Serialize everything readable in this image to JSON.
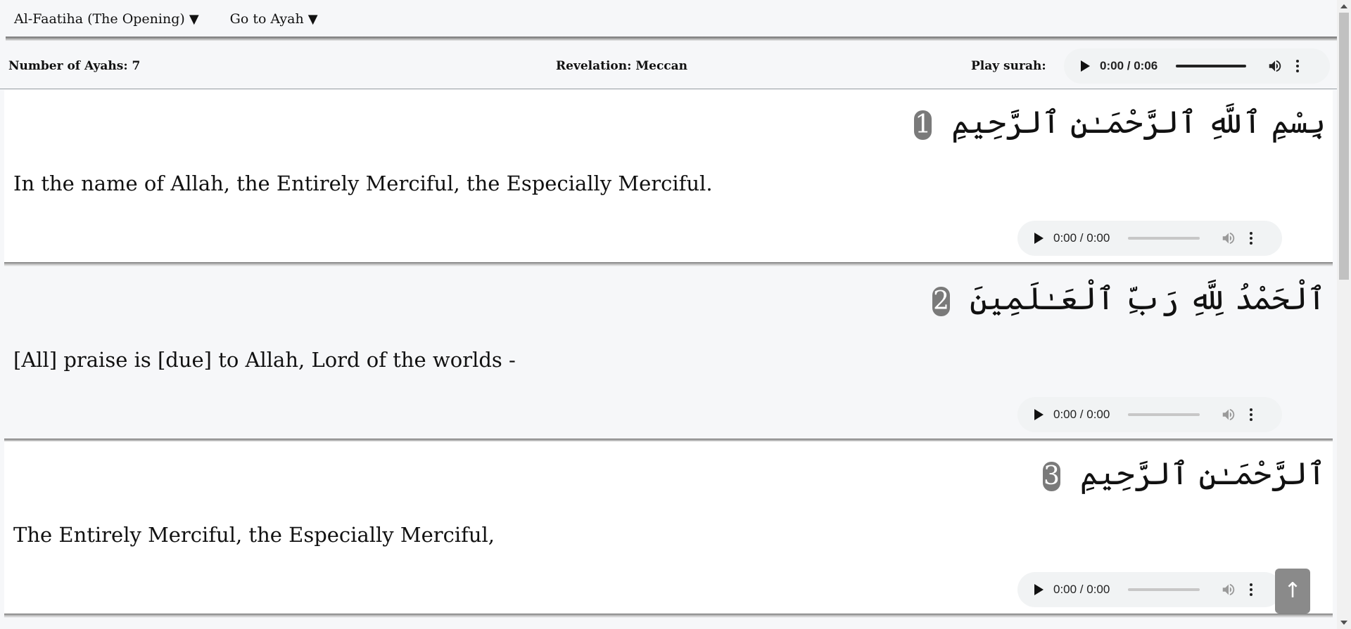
{
  "nav": {
    "surah_select": "Al-Faatiha (The Opening)",
    "goto_ayah": "Go to Ayah",
    "caret": "▼"
  },
  "info": {
    "number_of_ayahs": "Number of Ayahs: 7",
    "revelation": "Revelation: Meccan",
    "play_surah": "Play surah:"
  },
  "surah_audio": {
    "time": "0:00 / 0:06",
    "enabled": true
  },
  "ayahs": [
    {
      "number": "1",
      "arabic": "بِسْمِ ٱللَّهِ ٱلرَّحْمَـٰنِ ٱلرَّحِيمِ",
      "translation": "In the name of Allah, the Entirely Merciful, the Especially Merciful.",
      "audio_time": "0:00 / 0:00"
    },
    {
      "number": "2",
      "arabic": "ٱلْحَمْدُ لِلَّهِ رَبِّ ٱلْعَـٰلَمِينَ",
      "translation": "[All] praise is [due] to Allah, Lord of the worlds -",
      "audio_time": "0:00 / 0:00"
    },
    {
      "number": "3",
      "arabic": "ٱلرَّحْمَـٰنِ ٱلرَّحِيمِ",
      "translation": "The Entirely Merciful, the Especially Merciful,",
      "audio_time": "0:00 / 0:00"
    }
  ],
  "scroll_top": "↑",
  "icons": {
    "play": "play-icon",
    "volume": "volume-icon",
    "more": "more-options-icon",
    "scroll_up": "arrow-up-icon"
  },
  "colors": {
    "background": "#f6f7f9",
    "card_white": "#ffffff",
    "ayah_number_badge": "#7a7a7a",
    "audio_bg": "#f1f3f4",
    "audio_bar_active": "#222222",
    "audio_bar_disabled": "#c7c7c7"
  }
}
